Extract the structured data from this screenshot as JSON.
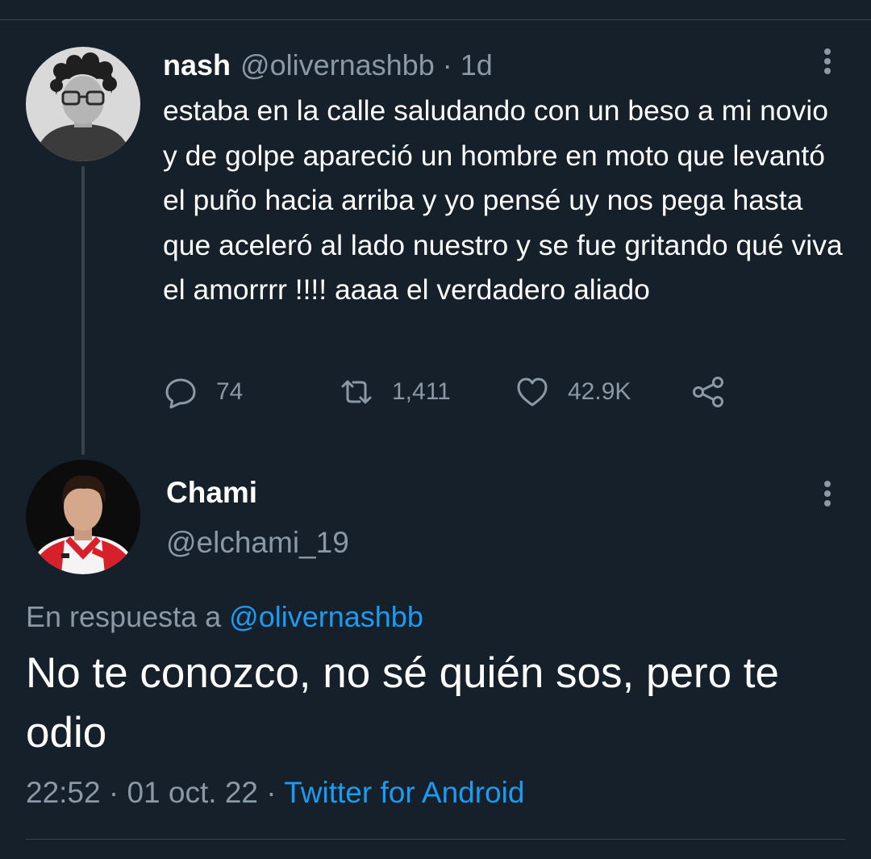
{
  "parent_tweet": {
    "display_name": "nash",
    "handle": "@olivernashbb",
    "separator": "·",
    "time_ago": "1d",
    "text": "estaba en la calle saludando con un beso a mi novio y de golpe apareció un hombre en moto que levantó el puño hacia arriba y yo pensé uy nos pega hasta que aceleró al lado nuestro y se fue gritando qué viva el amorrrr !!!! aaaa el verdadero aliado",
    "stats": {
      "replies": "74",
      "retweets": "1,411",
      "likes": "42.9K"
    },
    "avatar_icon": "user-photo-curly-hair-glasses"
  },
  "reply_tweet": {
    "display_name": "Chami",
    "handle": "@elchami_19",
    "replying_to_label": "En respuesta a",
    "replying_to_handle": "@olivernashbb",
    "text": "No te conozco, no sé quién sos, pero te odio",
    "time": "22:52",
    "date": "01 oct. 22",
    "separator": "·",
    "source": "Twitter for Android",
    "avatar_icon": "user-photo-football-jersey"
  },
  "colors": {
    "background": "#15202b",
    "text_primary": "#ffffff",
    "text_secondary": "#8b98a5",
    "accent": "#1d9bf0",
    "divider": "#38444d"
  }
}
